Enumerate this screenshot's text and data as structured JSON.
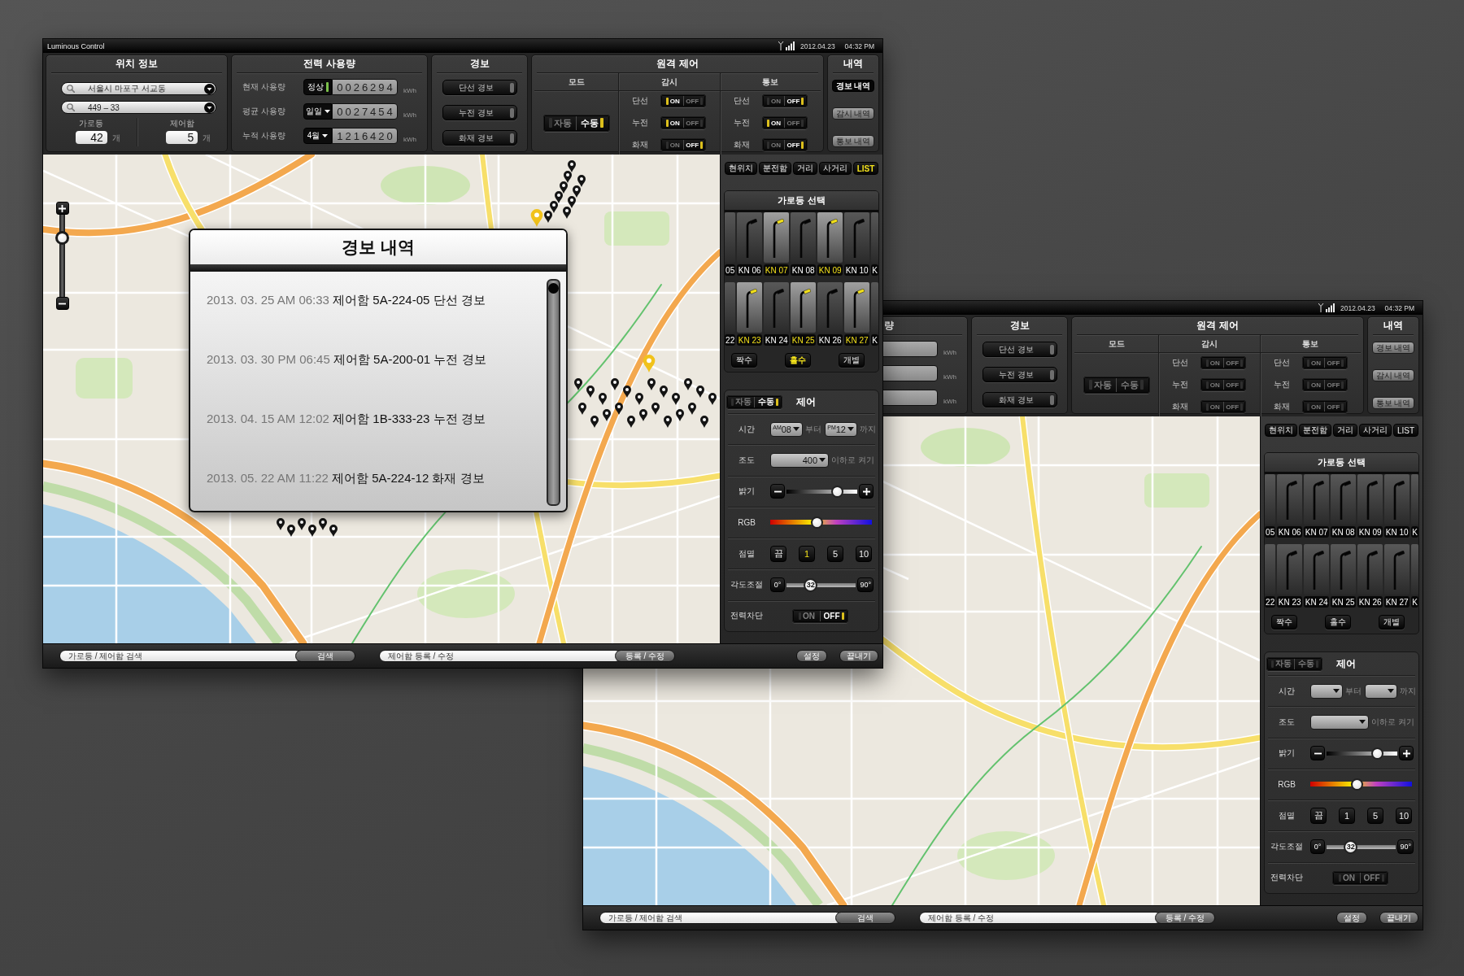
{
  "windows": [
    {
      "title": "Luminous Control",
      "status": {
        "date": "2012.04.23",
        "time": "04:32 PM"
      },
      "location": {
        "title": "위치 정보",
        "fields": [
          {
            "value": "서울시 마포구 서교동"
          },
          {
            "value": "449 – 33"
          }
        ],
        "counts": [
          {
            "label": "가로등",
            "value": "42",
            "unit": "개"
          },
          {
            "label": "제어함",
            "value": "5",
            "unit": "개"
          }
        ]
      },
      "power": {
        "title": "전력 사용량",
        "rows": [
          {
            "label": "현재 사용량",
            "badge": {
              "kind": "status",
              "text": "정상"
            },
            "value": "0026294",
            "unit": "kWh"
          },
          {
            "label": "평균 사용량",
            "badge": {
              "kind": "select",
              "text": "일일"
            },
            "value": "0027454",
            "unit": "kWh"
          },
          {
            "label": "누적 사용량",
            "badge": {
              "kind": "select",
              "text": "4월"
            },
            "value": "1216420",
            "unit": "kWh"
          }
        ]
      },
      "alarm": {
        "title": "경보",
        "buttons": [
          {
            "label": "단선 경보",
            "active": false
          },
          {
            "label": "누전 경보",
            "active": false
          },
          {
            "label": "화재 경보",
            "active": false
          }
        ]
      },
      "remote": {
        "title": "원격 제어",
        "mode": {
          "title": "모드",
          "options": [
            {
              "label": "자동",
              "selected": false
            },
            {
              "label": "수동",
              "selected": true
            }
          ]
        },
        "columns": [
          {
            "title": "감시",
            "rows": [
              {
                "label": "단선",
                "options": [
                  {
                    "label": "ON",
                    "selected": true
                  },
                  {
                    "label": "OFF",
                    "selected": false
                  }
                ]
              },
              {
                "label": "누전",
                "options": [
                  {
                    "label": "ON",
                    "selected": true
                  },
                  {
                    "label": "OFF",
                    "selected": false
                  }
                ]
              },
              {
                "label": "화재",
                "options": [
                  {
                    "label": "ON",
                    "selected": false
                  },
                  {
                    "label": "OFF",
                    "selected": true
                  }
                ]
              }
            ]
          },
          {
            "title": "통보",
            "rows": [
              {
                "label": "단선",
                "options": [
                  {
                    "label": "ON",
                    "selected": false
                  },
                  {
                    "label": "OFF",
                    "selected": true
                  }
                ]
              },
              {
                "label": "누전",
                "options": [
                  {
                    "label": "ON",
                    "selected": true
                  },
                  {
                    "label": "OFF",
                    "selected": false
                  }
                ]
              },
              {
                "label": "화재",
                "options": [
                  {
                    "label": "ON",
                    "selected": false
                  },
                  {
                    "label": "OFF",
                    "selected": true
                  }
                ]
              }
            ]
          }
        ]
      },
      "history": {
        "title": "내역",
        "buttons": [
          {
            "label": "경보 내역",
            "selected": true
          },
          {
            "label": "감시 내역",
            "selected": false
          },
          {
            "label": "통보 내역",
            "selected": false
          }
        ]
      },
      "map": {
        "markers": true,
        "zoom": {
          "level": 0.76
        }
      },
      "popup": {
        "title": "경보 내역",
        "entries": [
          {
            "time": "2013. 03. 25 AM 06:33",
            "message": "제어함 5A-224-05 단선 경보"
          },
          {
            "time": "2013. 03. 30 PM 06:45",
            "message": "제어함 5A-200-01 누전 경보"
          },
          {
            "time": "2013. 04. 15 AM 12:02",
            "message": "제어함 1B-333-23 누전 경보"
          },
          {
            "time": "2013. 05. 22 AM 11:22",
            "message": "제어함 5A-224-12 화재 경보"
          }
        ]
      },
      "side": {
        "tabs": [
          {
            "label": "현위치",
            "selected": false
          },
          {
            "label": "분전함",
            "selected": false
          },
          {
            "label": "거리",
            "selected": false
          },
          {
            "label": "사거리",
            "selected": false
          },
          {
            "label": "LIST",
            "selected": true
          }
        ],
        "lamps": {
          "title": "가로등 선택",
          "rows": [
            {
              "lamps": [
                {
                  "kind": "edge",
                  "label": "05",
                  "selected": false
                },
                {
                  "kind": "lamp",
                  "label": "KN 06",
                  "selected": false
                },
                {
                  "kind": "lamp",
                  "label": "KN 07",
                  "selected": true
                },
                {
                  "kind": "lamp",
                  "label": "KN 08",
                  "selected": false
                },
                {
                  "kind": "lamp",
                  "label": "KN 09",
                  "selected": true
                },
                {
                  "kind": "lamp",
                  "label": "KN 10",
                  "selected": false
                },
                {
                  "kind": "edge",
                  "label": "K",
                  "selected": false
                }
              ]
            },
            {
              "lamps": [
                {
                  "kind": "edge",
                  "label": "22",
                  "selected": false
                },
                {
                  "kind": "lamp",
                  "label": "KN 23",
                  "selected": true
                },
                {
                  "kind": "lamp",
                  "label": "KN 24",
                  "selected": false
                },
                {
                  "kind": "lamp",
                  "label": "KN 25",
                  "selected": true
                },
                {
                  "kind": "lamp",
                  "label": "KN 26",
                  "selected": false
                },
                {
                  "kind": "lamp",
                  "label": "KN 27",
                  "selected": true
                },
                {
                  "kind": "edge",
                  "label": "K",
                  "selected": false
                }
              ]
            }
          ],
          "groups": [
            {
              "label": "짝수",
              "selected": false
            },
            {
              "label": "홀수",
              "selected": true
            },
            {
              "label": "개별",
              "selected": false
            }
          ]
        },
        "control": {
          "title": "제어",
          "mode": {
            "options": [
              {
                "label": "자동",
                "selected": false
              },
              {
                "label": "수동",
                "selected": true
              }
            ]
          },
          "rows": [
            {
              "kind": "time",
              "label": "시간",
              "from": {
                "value": "$^{AM}$08",
                "suffix": "부터"
              },
              "to": {
                "value": "$^{PM}$12",
                "suffix": "까지"
              }
            },
            {
              "kind": "select",
              "label": "조도",
              "value": "400",
              "suffix": "이하로 켜기"
            },
            {
              "kind": "slider",
              "label": "밝기",
              "level": 0.76
            },
            {
              "kind": "spectrum",
              "label": "RGB",
              "level": 0.45
            },
            {
              "kind": "choice",
              "label": "점멸",
              "options": [
                {
                  "label": "끔",
                  "selected": false
                },
                {
                  "label": "1",
                  "selected": true
                },
                {
                  "label": "5",
                  "selected": false
                },
                {
                  "label": "10",
                  "selected": false
                }
              ]
            },
            {
              "kind": "range",
              "label": "각도조절",
              "min": "0°",
              "max": "90°",
              "reading": "32",
              "level": 0.31
            },
            {
              "kind": "toggle",
              "label": "전력차단",
              "options": [
                {
                  "label": "ON",
                  "selected": false
                },
                {
                  "label": "OFF",
                  "selected": true
                }
              ]
            }
          ]
        }
      },
      "bottom": {
        "fields": [
          {
            "placeholder": "가로등 / 제어함 검색",
            "button": "검색"
          },
          {
            "placeholder": "제어함 등록 / 수정",
            "button": "등록 / 수정"
          }
        ],
        "buttons": [
          "설정",
          "끝내기"
        ]
      }
    },
    {
      "status": {
        "date": "2012.04.23",
        "time": "04:32 PM"
      },
      "power": {
        "title": "량",
        "rows": [
          {
            "unit": "kWh"
          },
          {
            "unit": "kWh"
          },
          {
            "unit": "kWh"
          }
        ]
      },
      "alarm": {
        "title": "경보",
        "buttons": [
          {
            "label": "단선 경보",
            "active": false
          },
          {
            "label": "누전 경보",
            "active": false
          },
          {
            "label": "화재 경보",
            "active": false
          }
        ]
      },
      "remote": {
        "title": "원격 제어",
        "mode": {
          "title": "모드",
          "options": [
            {
              "label": "자동",
              "selected": false
            },
            {
              "label": "수동",
              "selected": false
            }
          ]
        },
        "columns": [
          {
            "title": "감시",
            "rows": [
              {
                "label": "단선",
                "options": [
                  {
                    "label": "ON",
                    "selected": false
                  },
                  {
                    "label": "OFF",
                    "selected": false
                  }
                ]
              },
              {
                "label": "누전",
                "options": [
                  {
                    "label": "ON",
                    "selected": false
                  },
                  {
                    "label": "OFF",
                    "selected": false
                  }
                ]
              },
              {
                "label": "화재",
                "options": [
                  {
                    "label": "ON",
                    "selected": false
                  },
                  {
                    "label": "OFF",
                    "selected": false
                  }
                ]
              }
            ]
          },
          {
            "title": "통보",
            "rows": [
              {
                "label": "단선",
                "options": [
                  {
                    "label": "ON",
                    "selected": false
                  },
                  {
                    "label": "OFF",
                    "selected": false
                  }
                ]
              },
              {
                "label": "누전",
                "options": [
                  {
                    "label": "ON",
                    "selected": false
                  },
                  {
                    "label": "OFF",
                    "selected": false
                  }
                ]
              },
              {
                "label": "화재",
                "options": [
                  {
                    "label": "ON",
                    "selected": false
                  },
                  {
                    "label": "OFF",
                    "selected": false
                  }
                ]
              }
            ]
          }
        ]
      },
      "history": {
        "title": "내역",
        "buttons": [
          {
            "label": "경보 내역",
            "selected": false
          },
          {
            "label": "감시 내역",
            "selected": false
          },
          {
            "label": "통보 내역",
            "selected": false
          }
        ]
      },
      "map": {
        "markers": false
      },
      "side": {
        "tabs": [
          {
            "label": "현위치",
            "selected": false
          },
          {
            "label": "분전함",
            "selected": false
          },
          {
            "label": "거리",
            "selected": false
          },
          {
            "label": "사거리",
            "selected": false
          },
          {
            "label": "LIST",
            "selected": false
          }
        ],
        "lamps": {
          "title": "가로등 선택",
          "rows": [
            {
              "lamps": [
                {
                  "kind": "edge",
                  "label": "05",
                  "selected": false
                },
                {
                  "kind": "lamp",
                  "label": "KN 06",
                  "selected": false
                },
                {
                  "kind": "lamp",
                  "label": "KN 07",
                  "selected": false
                },
                {
                  "kind": "lamp",
                  "label": "KN 08",
                  "selected": false
                },
                {
                  "kind": "lamp",
                  "label": "KN 09",
                  "selected": false
                },
                {
                  "kind": "lamp",
                  "label": "KN 10",
                  "selected": false
                },
                {
                  "kind": "edge",
                  "label": "K",
                  "selected": false
                }
              ]
            },
            {
              "lamps": [
                {
                  "kind": "edge",
                  "label": "22",
                  "selected": false
                },
                {
                  "kind": "lamp",
                  "label": "KN 23",
                  "selected": false
                },
                {
                  "kind": "lamp",
                  "label": "KN 24",
                  "selected": false
                },
                {
                  "kind": "lamp",
                  "label": "KN 25",
                  "selected": false
                },
                {
                  "kind": "lamp",
                  "label": "KN 26",
                  "selected": false
                },
                {
                  "kind": "lamp",
                  "label": "KN 27",
                  "selected": false
                },
                {
                  "kind": "edge",
                  "label": "K",
                  "selected": false
                }
              ]
            }
          ],
          "groups": [
            {
              "label": "짝수",
              "selected": false
            },
            {
              "label": "홀수",
              "selected": false
            },
            {
              "label": "개별",
              "selected": false
            }
          ]
        },
        "control": {
          "title": "제어",
          "mode": {
            "options": [
              {
                "label": "자동",
                "selected": false
              },
              {
                "label": "수동",
                "selected": false
              }
            ]
          },
          "rows": [
            {
              "kind": "time",
              "label": "시간",
              "from": {
                "suffix": "부터"
              },
              "to": {
                "suffix": "까지"
              }
            },
            {
              "kind": "select",
              "label": "조도",
              "suffix": "이하로 켜기"
            },
            {
              "kind": "slider",
              "label": "밝기",
              "level": 0.76
            },
            {
              "kind": "spectrum",
              "label": "RGB",
              "level": 0.45
            },
            {
              "kind": "choice",
              "label": "점멸",
              "options": [
                {
                  "label": "끔",
                  "selected": false
                },
                {
                  "label": "1",
                  "selected": false
                },
                {
                  "label": "5",
                  "selected": false
                },
                {
                  "label": "10",
                  "selected": false
                }
              ]
            },
            {
              "kind": "range",
              "label": "각도조절",
              "min": "0°",
              "max": "90°",
              "reading": "32",
              "level": 0.31
            },
            {
              "kind": "toggle",
              "label": "전력차단",
              "options": [
                {
                  "label": "ON",
                  "selected": false
                },
                {
                  "label": "OFF",
                  "selected": false
                }
              ]
            }
          ]
        }
      },
      "bottom": {
        "fields": [
          {
            "placeholder": "가로등 / 제어함 검색",
            "button": "검색"
          },
          {
            "placeholder": "제어함 등록 / 수정",
            "button": "등록 / 수정"
          }
        ],
        "buttons": [
          "설정",
          "끝내기"
        ]
      }
    }
  ]
}
